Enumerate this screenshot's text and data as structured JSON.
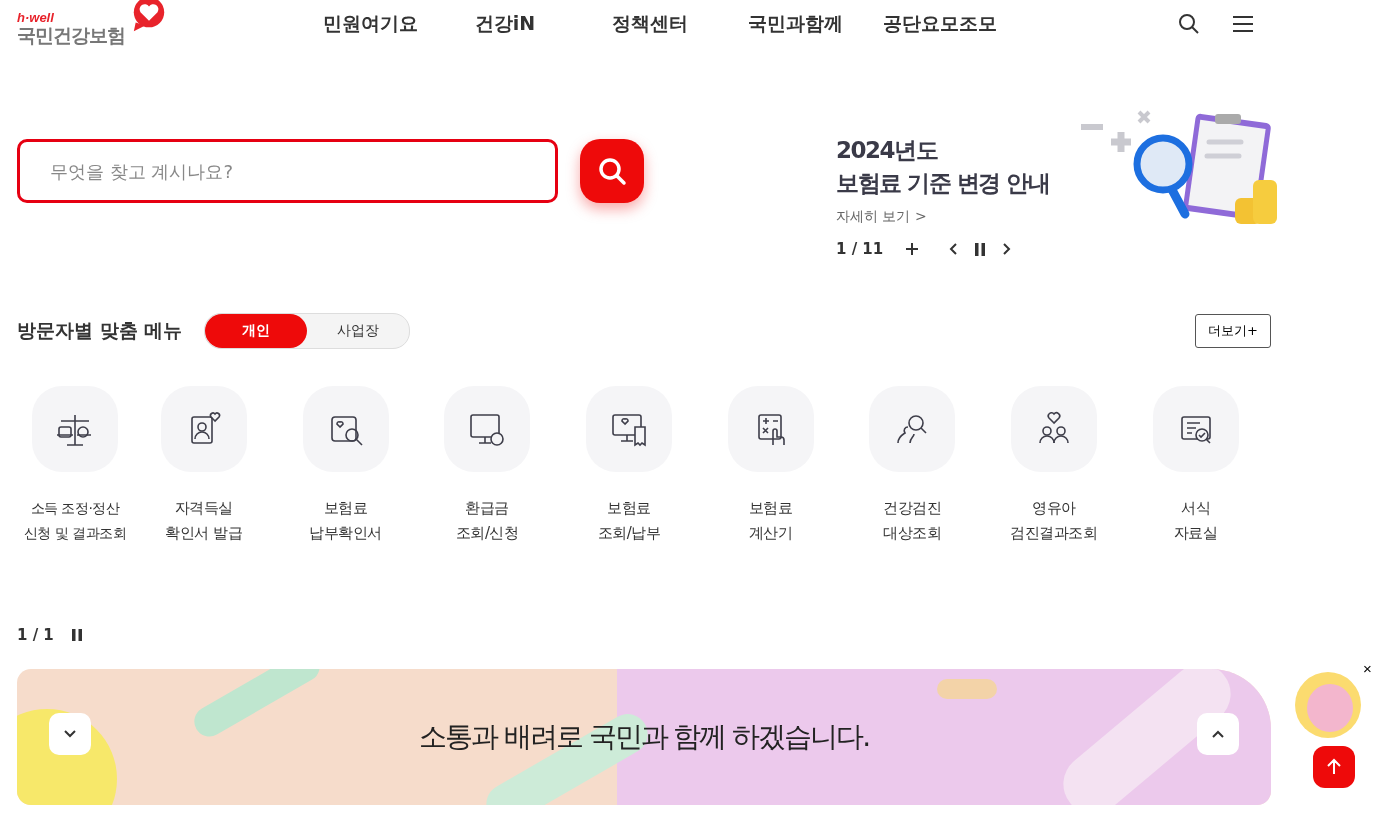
{
  "header": {
    "logo_tagline": "h·well",
    "logo_name": "국민건강보험",
    "nav": [
      "민원여기요",
      "건강iN",
      "정책센터",
      "국민과함께",
      "공단요모조모"
    ]
  },
  "search": {
    "placeholder": "무엇을 찾고 계시나요?"
  },
  "promo": {
    "title_lines": [
      "2024년도",
      "보험료 기준 변경 안내"
    ],
    "link": "자세히 보기 >",
    "pager": "1 / 11"
  },
  "menu": {
    "title": "방문자별 맞춤 메뉴",
    "tabs": [
      {
        "label": "개인",
        "selected": true
      },
      {
        "label": "사업장",
        "selected": false
      }
    ],
    "more": "더보기+",
    "items": [
      {
        "lines": [
          "소득 조정·정산",
          "신청 및 결과조회"
        ]
      },
      {
        "lines": [
          "자격득실",
          "확인서 발급"
        ]
      },
      {
        "lines": [
          "보험료",
          "납부확인서"
        ]
      },
      {
        "lines": [
          "환급금",
          "조회/신청"
        ]
      },
      {
        "lines": [
          "보험료",
          "조회/납부"
        ]
      },
      {
        "lines": [
          "보험료",
          "계산기"
        ]
      },
      {
        "lines": [
          "건강검진",
          "대상조회"
        ]
      },
      {
        "lines": [
          "영유아",
          "검진결과조회"
        ]
      },
      {
        "lines": [
          "서식",
          "자료실"
        ]
      }
    ],
    "pager": "1 / 1"
  },
  "banner": {
    "text": "소통과 배려로 국민과 함께 하겠습니다."
  },
  "floating": {
    "close": "×"
  }
}
